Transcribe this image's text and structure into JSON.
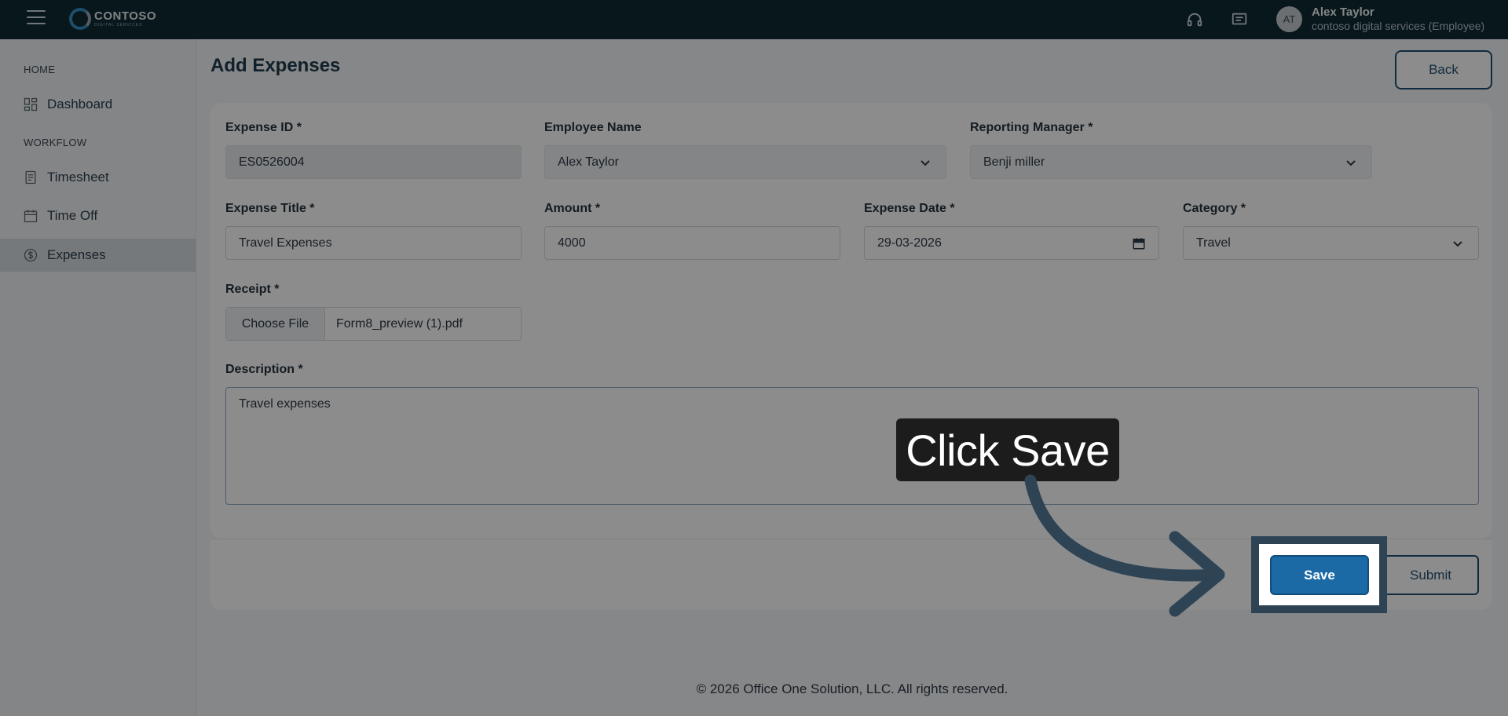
{
  "topbar": {
    "logo_main": "CONTOSO",
    "logo_sub": "DIGITAL SERVICES",
    "user_initials": "AT",
    "user_name": "Alex Taylor",
    "user_org": "contoso digital services (Employee)",
    "icons": [
      "menu-icon",
      "headset-icon",
      "message-icon"
    ]
  },
  "sidebar": {
    "sections": [
      {
        "title": "HOME"
      },
      {
        "title": "WORKFLOW"
      }
    ],
    "items": [
      {
        "label": "Dashboard",
        "icon": "dashboard-icon"
      },
      {
        "label": "Timesheet",
        "icon": "timesheet-icon"
      },
      {
        "label": "Time Off",
        "icon": "calendar-icon"
      },
      {
        "label": "Expenses",
        "icon": "dollar-icon",
        "active": true
      }
    ]
  },
  "page": {
    "title": "Add Expenses",
    "back_label": "Back"
  },
  "form": {
    "expense_id": {
      "label": "Expense ID *",
      "value": "ES0526004"
    },
    "employee_name": {
      "label": "Employee Name",
      "value": "Alex Taylor"
    },
    "reporting_manager": {
      "label": "Reporting Manager *",
      "value": "Benji miller"
    },
    "expense_title": {
      "label": "Expense Title *",
      "value": "Travel Expenses"
    },
    "amount": {
      "label": "Amount *",
      "value": "4000"
    },
    "expense_date": {
      "label": "Expense Date *",
      "value": "29-03-2026"
    },
    "category": {
      "label": "Category *",
      "value": "Travel"
    },
    "receipt": {
      "label": "Receipt *",
      "button": "Choose File",
      "file_name": "Form8_preview (1).pdf"
    },
    "description": {
      "label": "Description *",
      "value": "Travel expenses"
    }
  },
  "actions": {
    "save_label": "Save",
    "submit_label": "Submit"
  },
  "tooltip": {
    "text": "Click Save"
  },
  "footer": {
    "copyright": "© 2026 Office One Solution, LLC. All rights reserved."
  },
  "colors": {
    "topbar": "#0f2a33",
    "primary": "#1b6aa6",
    "outline": "#1f4f72"
  }
}
